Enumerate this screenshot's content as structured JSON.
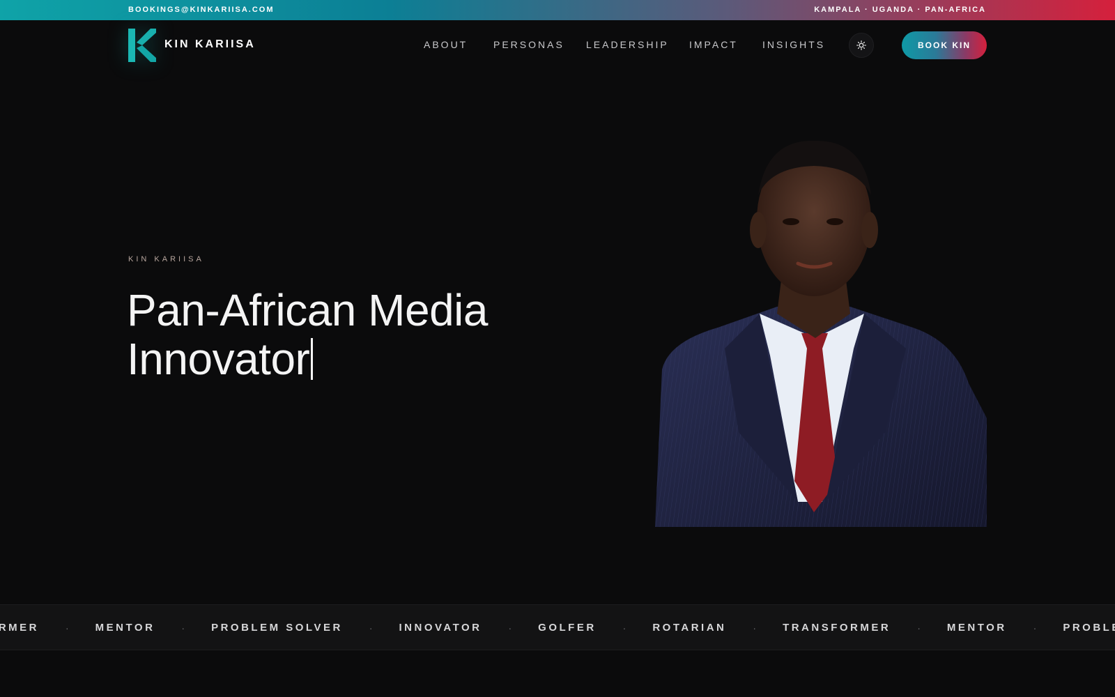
{
  "topbar": {
    "email": "BOOKINGS@KINKARIISA.COM",
    "region": "KAMPALA · UGANDA · PAN-AFRICA"
  },
  "header": {
    "brand": "KIN KARIISA",
    "nav": [
      "ABOUT",
      "PERSONAS",
      "LEADERSHIP",
      "IMPACT",
      "INSIGHTS"
    ],
    "theme_toggle_icon": "sun-icon",
    "cta_label": "BOOK KIN"
  },
  "hero": {
    "eyebrow": "KIN KARIISA",
    "headline_line1": "Pan-African Media",
    "headline_line2": "Innovator",
    "portrait_alt": "Portrait of Kin Kariisa"
  },
  "marquee": {
    "items": [
      "FORMER",
      "MENTOR",
      "PROBLEM SOLVER",
      "INNOVATOR",
      "GOLFER",
      "ROTARIAN",
      "TRANSFORMER",
      "MENTOR",
      "PROBLEM SOLVER"
    ],
    "separator": "·"
  },
  "colors": {
    "background": "#0b0b0c",
    "accent_teal": "#0fa3a8",
    "accent_red": "#d5203c"
  }
}
